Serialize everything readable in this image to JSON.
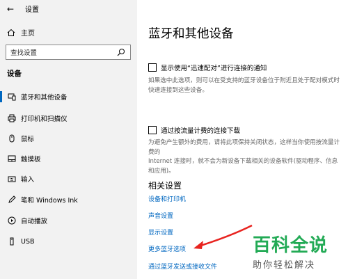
{
  "window": {
    "title": "设置"
  },
  "sidebar": {
    "home_label": "主页",
    "search_placeholder": "查找设置",
    "section_label": "设备",
    "items": [
      {
        "label": "蓝牙和其他设备",
        "icon": "bluetooth-icon",
        "active": true
      },
      {
        "label": "打印机和扫描仪",
        "icon": "printer-icon",
        "active": false
      },
      {
        "label": "鼠标",
        "icon": "mouse-icon",
        "active": false
      },
      {
        "label": "触摸板",
        "icon": "touchpad-icon",
        "active": false
      },
      {
        "label": "输入",
        "icon": "keyboard-icon",
        "active": false
      },
      {
        "label": "笔和 Windows Ink",
        "icon": "pen-icon",
        "active": false
      },
      {
        "label": "自动播放",
        "icon": "autoplay-icon",
        "active": false
      },
      {
        "label": "USB",
        "icon": "usb-icon",
        "active": false
      }
    ]
  },
  "main": {
    "title": "蓝牙和其他设备",
    "swift_pair": {
      "label": "显示使用“迅速配对”进行连接的通知",
      "checked": false,
      "desc_line1": "如果选中此选项，则可以在受支持的蓝牙设备位于附近且处于配对模式时",
      "desc_line2": "快速连接到这些设备。"
    },
    "metered": {
      "label": "通过按流量计费的连接下载",
      "checked": false,
      "desc_line1": "为避免产生额外的费用，请将此项保持关闭状态，这样当你使用按流量计费的",
      "desc_line2": "Internet 连接时，就不会为新设备下载相关的设备软件(驱动程序、信息",
      "desc_line3": "和应用)。"
    },
    "related": {
      "title": "相关设置",
      "links": [
        "设备和打印机",
        "声音设置",
        "显示设置",
        "更多蓝牙选项",
        "通过蓝牙发送或接收文件"
      ]
    }
  },
  "watermark": {
    "title": "百科全说",
    "subtitle": "助你轻松解决"
  },
  "colors": {
    "accent": "#0067c0",
    "sidebar_bg": "#f2f2f2",
    "annotation_arrow": "#e8231f",
    "watermark_green": "#22aa55"
  }
}
